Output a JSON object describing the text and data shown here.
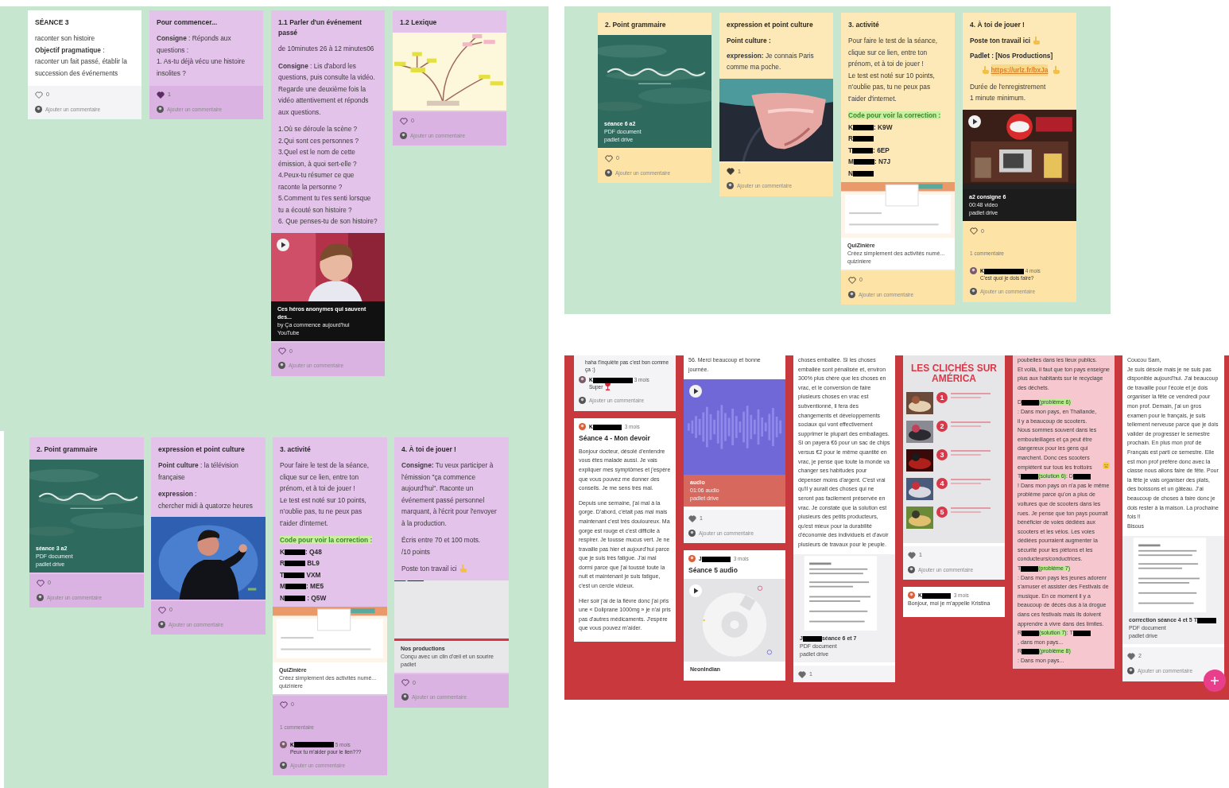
{
  "panels": [
    {
      "columns": [
        {
          "cards": [
            {
              "body": [
                {
                  "kind": "title",
                  "text": "SÉANCE 3"
                },
                {
                  "kind": "text",
                  "text": "raconter son histoire\n**Objectif pragmatique** :\nraconter un fait passé, établir la succession des événements"
                }
              ],
              "footer": [
                {
                  "kind": "likes",
                  "liked": false,
                  "count": "0"
                },
                {
                  "kind": "prompt",
                  "text": "Ajouter un commentaire"
                }
              ]
            }
          ]
        },
        {
          "cards": [
            {
              "body": [
                {
                  "kind": "title",
                  "text": "Pour commencer..."
                },
                {
                  "kind": "text",
                  "text": "**Consigne** : Réponds aux questions :\n1. As-tu déjà vécu une histoire insolites ?"
                }
              ],
              "footer": [
                {
                  "kind": "likes",
                  "liked": true,
                  "count": "1"
                },
                {
                  "kind": "prompt",
                  "text": "Ajouter un commentaire"
                }
              ]
            }
          ]
        },
        {
          "cards": [
            {
              "body": [
                {
                  "kind": "title",
                  "text": "1.1 Parler d'un événement passé"
                },
                {
                  "kind": "text",
                  "text": "de 10minutes 26 à 12 minutes06"
                },
                {
                  "kind": "text",
                  "text": "**Consigne** : Lis d'abord les questions, puis consulte la vidéo. Regarde une deuxième fois la vidéo attentivement et réponds aux questions."
                },
                {
                  "kind": "text",
                  "text": "1.Où se déroule la scène ?\n2.Qui sont ces personnes ?\n3.Quel est le nom de cette émission, à quoi sert-elle ?\n4.Peux-tu résumer ce que raconte la personne ?\n5.Comment tu t'es senti lorsque tu a écouté son histoire ?\n6. Que penses-tu de son histoire?"
                },
                {
                  "kind": "media",
                  "caption": [
                    [
                      "Ces héros anonymes qui sauvent des..."
                    ],
                    [
                      "by Ça commence aujourd'hui"
                    ],
                    [
                      "YouTube"
                    ]
                  ]
                }
              ],
              "footer": [
                {
                  "kind": "likes",
                  "liked": false,
                  "count": "0"
                },
                {
                  "kind": "prompt",
                  "text": "Ajouter un commentaire"
                }
              ]
            }
          ]
        },
        {
          "cards": [
            {
              "body": [
                {
                  "kind": "title",
                  "text": "1.2 Lexique"
                },
                {
                  "kind": "media"
                }
              ],
              "footer": [
                {
                  "kind": "likes",
                  "liked": false,
                  "count": "0"
                },
                {
                  "kind": "prompt",
                  "text": "Ajouter un commentaire"
                }
              ]
            }
          ]
        }
      ]
    },
    {
      "columns": [
        {
          "cards": [
            {
              "body": [
                {
                  "kind": "title",
                  "text": "2. Point grammaire"
                },
                {
                  "kind": "media",
                  "caption": [
                    [
                      "séance 3 a2"
                    ],
                    [
                      "PDF document"
                    ],
                    [
                      "padlet drive"
                    ]
                  ]
                }
              ],
              "footer": [
                {
                  "kind": "likes",
                  "liked": false,
                  "count": "0"
                },
                {
                  "kind": "prompt",
                  "text": "Ajouter un commentaire"
                }
              ]
            }
          ]
        },
        {
          "cards": [
            {
              "body": [
                {
                  "kind": "title",
                  "text": "expression et point culture"
                },
                {
                  "kind": "text",
                  "text": "**Point culture** : la télévision française"
                },
                {
                  "kind": "text",
                  "text": "**expression** :\nchercher midi à quatorze heures"
                },
                {
                  "kind": "media"
                }
              ],
              "footer": [
                {
                  "kind": "likes",
                  "liked": false,
                  "count": "0"
                },
                {
                  "kind": "prompt",
                  "text": "Ajouter un commentaire"
                }
              ]
            }
          ]
        },
        {
          "cards": [
            {
              "body": [
                {
                  "kind": "title",
                  "text": "3. activité"
                },
                {
                  "kind": "text",
                  "text": "Pour faire le test de la séance, clique sur ce lien, entre ton prénom, et à toi de jouer !\nLe test est noté sur 10 points, n'oublie pas, tu ne peux pas t'aider d'internet."
                },
                {
                  "kind": "highlight",
                  "text": "Code pour voir la correction :"
                },
                {
                  "kind": "codes",
                  "lines": [
                    [
                      "K",
                      {
                        "kind": "redacted"
                      },
                      ": Q48"
                    ],
                    [
                      "R",
                      {
                        "kind": "redacted"
                      },
                      " BL9"
                    ],
                    [
                      "T",
                      {
                        "kind": "redacted"
                      },
                      " VXM"
                    ],
                    [
                      "M",
                      {
                        "kind": "redacted"
                      },
                      ": ME5"
                    ],
                    [
                      "N",
                      {
                        "kind": "redacted"
                      },
                      " : Q5W"
                    ]
                  ]
                },
                {
                  "kind": "media",
                  "caption": [
                    [
                      "QuiZinière"
                    ],
                    [
                      "Créez simplement des activités numé..."
                    ],
                    [
                      "quiziniere"
                    ]
                  ]
                }
              ],
              "footer": [
                {
                  "kind": "likes",
                  "liked": false,
                  "count": "0"
                },
                {
                  "kind": "comment_count",
                  "text": "1 commentaire"
                },
                {
                  "kind": "comment",
                  "author": [
                    "K",
                    {
                      "kind": "redacted"
                    }
                  ],
                  "time": "5 mois",
                  "text": "Peux tu m'aider pour le lien???"
                },
                {
                  "kind": "prompt",
                  "text": "Ajouter un commentaire"
                }
              ]
            }
          ]
        },
        {
          "cards": [
            {
              "body": [
                {
                  "kind": "title",
                  "text": "4. À toi de jouer !"
                },
                {
                  "kind": "text",
                  "text": "**Consigne:** Tu veux participer à l'émission \"ça commence aujourd'hui\". Raconte un événement passé personnel marquant, à l'écrit pour l'envoyer à la production."
                },
                {
                  "kind": "text",
                  "text": "Écris entre 70 et 100 mots.\n/10 points"
                },
                {
                  "kind": "text",
                  "text": "Poste ton travail ici"
                },
                {
                  "kind": "media",
                  "caption": [
                    [
                      "Nos productions"
                    ],
                    [
                      "Conçu avec un clin d'œil et un sourire"
                    ],
                    [
                      "padlet"
                    ]
                  ]
                }
              ],
              "footer": [
                {
                  "kind": "likes",
                  "liked": false,
                  "count": "0"
                },
                {
                  "kind": "prompt",
                  "text": "Ajouter un commentaire"
                }
              ]
            }
          ]
        }
      ]
    },
    {
      "columns": [
        {
          "cards": [
            {
              "body": [
                {
                  "kind": "title",
                  "text": "2. Point grammaire"
                },
                {
                  "kind": "media",
                  "caption": [
                    [
                      "séance 6 a2"
                    ],
                    [
                      "PDF document"
                    ],
                    [
                      "padlet drive"
                    ]
                  ]
                }
              ],
              "footer": [
                {
                  "kind": "likes",
                  "liked": false,
                  "count": "0"
                },
                {
                  "kind": "prompt",
                  "text": "Ajouter un commentaire"
                }
              ]
            }
          ]
        },
        {
          "cards": [
            {
              "body": [
                {
                  "kind": "title",
                  "text": "expression et point culture"
                },
                {
                  "kind": "label",
                  "text": "Point culture :"
                },
                {
                  "kind": "text",
                  "text": "**expression:** Je connais Paris comme ma poche."
                },
                {
                  "kind": "media"
                }
              ],
              "footer": [
                {
                  "kind": "likes",
                  "liked": true,
                  "count": "1"
                },
                {
                  "kind": "prompt",
                  "text": "Ajouter un commentaire"
                }
              ]
            }
          ]
        },
        {
          "cards": [
            {
              "body": [
                {
                  "kind": "title",
                  "text": "3. activité"
                },
                {
                  "kind": "text",
                  "text": "Pour faire le test de la séance, clique sur ce lien, entre ton prénom, et à toi de jouer !\nLe test est noté sur 10 points, n'oublie pas, tu ne peux pas t'aider d'internet."
                },
                {
                  "kind": "highlight",
                  "text": "Code pour voir la correction :"
                },
                {
                  "kind": "codes",
                  "lines": [
                    [
                      "K",
                      {
                        "kind": "redacted"
                      },
                      ": K9W"
                    ],
                    [
                      "R",
                      {
                        "kind": "redacted"
                      }
                    ],
                    [
                      "T",
                      {
                        "kind": "redacted"
                      },
                      ": 6EP"
                    ],
                    [
                      "M",
                      {
                        "kind": "redacted"
                      },
                      ": N7J"
                    ],
                    [
                      "N",
                      {
                        "kind": "redacted"
                      }
                    ]
                  ]
                },
                {
                  "kind": "media",
                  "caption": [
                    [
                      "QuiZinière"
                    ],
                    [
                      "Créez simplement des activités numé..."
                    ],
                    [
                      "quiziniere"
                    ]
                  ]
                }
              ],
              "footer": [
                {
                  "kind": "likes",
                  "liked": false,
                  "count": "0"
                },
                {
                  "kind": "prompt",
                  "text": "Ajouter un commentaire"
                }
              ]
            }
          ]
        },
        {
          "cards": [
            {
              "body": [
                {
                  "kind": "title",
                  "text": "4. À toi de jouer !"
                },
                {
                  "kind": "label",
                  "text": "Poste ton travail ici"
                },
                {
                  "kind": "label",
                  "text": "Padlet : [Nos Productions]"
                },
                {
                  "kind": "link",
                  "text": "https://urlz.fr/bxJa"
                },
                {
                  "kind": "text",
                  "text": "Durée de l'enregistrement\n1 minute minimum."
                },
                {
                  "kind": "media",
                  "caption": [
                    [
                      "a2 consigne 6"
                    ],
                    [
                      "00:48 video"
                    ],
                    [
                      "padlet drive"
                    ]
                  ]
                }
              ],
              "footer": [
                {
                  "kind": "likes",
                  "liked": false,
                  "count": "0"
                },
                {
                  "kind": "comment_count",
                  "text": "1 commentaire"
                },
                {
                  "kind": "comment",
                  "author": [
                    "K",
                    {
                      "kind": "redacted"
                    }
                  ],
                  "time": "4 mois",
                  "text": "C'est quoi je dois faire?"
                },
                {
                  "kind": "prompt",
                  "text": "Ajouter un commentaire"
                }
              ]
            }
          ]
        }
      ]
    },
    {
      "columns": [
        {
          "cards": [
            {
              "footer": [
                {
                  "kind": "comment_tail",
                  "text": "haha t'inquiète pas c'est bon comme ça :)"
                },
                {
                  "kind": "comment",
                  "author": [
                    "K",
                    {
                      "kind": "redacted"
                    }
                  ],
                  "time": "3 mois",
                  "text": "Super"
                },
                {
                  "kind": "prompt",
                  "text": "Ajouter un commentaire"
                }
              ]
            },
            {
              "body": [
                {
                  "kind": "author",
                  "author": [
                    "K",
                    {
                      "kind": "redacted"
                    }
                  ],
                  "time": "3 mois"
                },
                {
                  "kind": "title",
                  "text": "Séance 4 - Mon devoir"
                },
                {
                  "kind": "text",
                  "text": "Bonjour docteur, désolé d'entendre vous êtes malade aussi. Je vais expliquer mes symptômes et j'espère que vous pouvez me donner des conseils. Je me sens très mal."
                },
                {
                  "kind": "text",
                  "text": "Depuis une semaine, j'ai mal à la gorge. D'abord, c'était pas mal mais maintenant c'est très douloureux. Ma gorge est rouge et c'est difficile à respirer. Je tousse mucus vert. Je ne travaille pas hier et aujourd'hui parce que je suis très fatigue. J'ai mal dormi parce que j'ai toussé toute la nuit et maintenant je suis fatigue, c'est un cercle vicieux."
                },
                {
                  "kind": "text",
                  "text": "Hier soir j'ai de la fièvre donc j'ai pris une « Doliprane 1000mg » je n'ai pris pas d'autres médicaments. J'espère que vous pouvez m'aider."
                }
              ]
            }
          ]
        },
        {
          "cards": [
            {
              "body": [
                {
                  "kind": "text",
                  "text": "56. Merci beaucoup et bonne journée."
                },
                {
                  "kind": "media",
                  "caption": [
                    [
                      "audio"
                    ],
                    [
                      "01:06 audio"
                    ],
                    [
                      "padlet drive"
                    ]
                  ]
                }
              ],
              "footer": [
                {
                  "kind": "likes",
                  "liked": true,
                  "count": "1"
                },
                {
                  "kind": "prompt",
                  "text": "Ajouter un commentaire"
                }
              ]
            },
            {
              "body": [
                {
                  "kind": "author",
                  "author": [
                    "J",
                    {
                      "kind": "redacted"
                    }
                  ],
                  "time": "3 mois"
                },
                {
                  "kind": "title",
                  "text": "Séance 5 audio"
                },
                {
                  "kind": "media",
                  "caption": [
                    [
                      "NeonIndian"
                    ]
                  ]
                }
              ]
            }
          ]
        },
        {
          "cards": [
            {
              "body": [
                {
                  "kind": "text",
                  "text": "choses emballée. Si les choses emballée sont pénalisée et, environ 300% plus chère que les choses en vrac, et le conversion de faire plusieurs choses en vrac est subventionné, il fera des changements et développements sociaux qui vont effectivement supprimer le plupart des emballages. Si on payera €6 pour un sac de chips versus €2 pour le même quantité en vrac, je pense que toute la monde va changer ses habitudes pour dépenser moins d'argent. C'est vrai qu'il y aurait des choses qui ne seront pas facilement préservée en vrac. Je constate que la solution est plusieurs des petits producteurs, qu'est mieux pour la durabilité d'économie des individuels et d'avoir plusieurs de travaux pour le peuple."
                },
                {
                  "kind": "media",
                  "caption": [
                    [
                      "J",
                      {
                        "kind": "redacted"
                      },
                      "séance 6 et 7"
                    ],
                    [
                      "PDF document"
                    ],
                    [
                      "padlet drive"
                    ]
                  ]
                }
              ],
              "footer": [
                {
                  "kind": "likes",
                  "liked": true,
                  "count": "1"
                }
              ]
            }
          ]
        },
        {
          "cards": [
            {
              "body": [
                {
                  "kind": "cliches",
                  "title": "LES CLICHÉS SUR AMÉRICA",
                  "items": [
                    "1",
                    "2",
                    "3",
                    "4",
                    "5"
                  ]
                }
              ],
              "footer": [
                {
                  "kind": "likes",
                  "liked": true,
                  "count": "1"
                },
                {
                  "kind": "prompt",
                  "text": "Ajouter un commentaire"
                }
              ]
            },
            {
              "body": [
                {
                  "kind": "author",
                  "author": [
                    "K",
                    {
                      "kind": "redacted"
                    }
                  ],
                  "time": "3 mois"
                },
                {
                  "kind": "text",
                  "text": "Bonjour, moi je m'appelle Kristina"
                }
              ]
            }
          ]
        },
        {
          "cards": [
            {
              "body": [
                {
                  "kind": "text",
                  "text": "poubelles dans les lieux publics.\nEt voilà, il faut que ton pays enseigne plus aux habitants sur le recyclage des déchets."
                },
                {
                  "kind": "segments",
                  "segs": [
                    "D",
                    {
                      "kind": "redacted"
                    },
                    {
                      "kind": "highlight",
                      "text": "(problème 6)"
                    },
                    ": Dans mon pays, en Thaïlande, il y a beaucoup de scooters. Nous sommes souvent dans les embouteillages et ça peut être dangereux pour les gens qui marchent. Donc ces scooters empiètent sur tous les trottoirs"
                  ]
                },
                {
                  "kind": "segments",
                  "segs": [
                    "T",
                    {
                      "kind": "redacted"
                    },
                    {
                      "kind": "highlight",
                      "text": "(solution 6)"
                    },
                    ": D",
                    {
                      "kind": "redacted"
                    },
                    "! Dans mon pays on n'a pas le même problème parce qu'on a plus de voitures que de scooters dans les rues. Je pense que ton pays pourrait bénéficier de voies dédiées aux scooters et les vélos. Les voies dédiées pourraient augmenter la sécurité pour les piétons et les conducteurs/conductrices."
                  ]
                },
                {
                  "kind": "segments",
                  "segs": [
                    "T",
                    {
                      "kind": "redacted"
                    },
                    {
                      "kind": "highlight",
                      "text": "(problème 7)"
                    },
                    ": Dans mon pays les jeunes adorenr s'amuser et assister des Festivals de musique. En ce moment il y a beaucoup de décès dus à la drogue dans ces festivals mais ils doivent apprendre à vivre dans des limites."
                  ]
                },
                {
                  "kind": "segments",
                  "segs": [
                    "R",
                    {
                      "kind": "redacted"
                    },
                    {
                      "kind": "highlight",
                      "text": "(solution 7)"
                    },
                    ": T",
                    {
                      "kind": "redacted"
                    },
                    ", dans mon pays..."
                  ]
                },
                {
                  "kind": "segments",
                  "segs": [
                    "R",
                    {
                      "kind": "redacted"
                    },
                    {
                      "kind": "highlight",
                      "text": "(problème 8)"
                    },
                    ": Dans mon pays..."
                  ]
                }
              ]
            }
          ]
        },
        {
          "cards": [
            {
              "body": [
                {
                  "kind": "text",
                  "text": "Coucou Sam,\nJe suis désole mais je ne suis pas disponible aujourd'hui. J'ai beaucoup de travaille pour l'école et je dois organiser la fête ce vendredi pour mon prof. Demain, j'ai un gros examen pour le français, je suis tellement nerveuse parce que je dois valider de progresser le semestre prochain. En plus mon prof de Français est parti ce semestre. Elle est mon prof préfère donc avec la classe nous allons faire de fête. Pour la fête je vais organiser des plats, des boissons et un gâteau. J'ai beaucoup de choses à faire donc je dois rester à la maison. La prochaine fois !!\nBisous"
                },
                {
                  "kind": "media",
                  "caption": [
                    [
                      "correction séance 4 et 5 T",
                      {
                        "kind": "redacted"
                      }
                    ],
                    [
                      "PDF document"
                    ],
                    [
                      "padlet drive"
                    ]
                  ]
                }
              ],
              "footer": [
                {
                  "kind": "likes",
                  "liked": true,
                  "count": "2"
                },
                {
                  "kind": "prompt",
                  "text": "Ajouter un commentaire"
                }
              ]
            }
          ]
        }
      ]
    }
  ]
}
